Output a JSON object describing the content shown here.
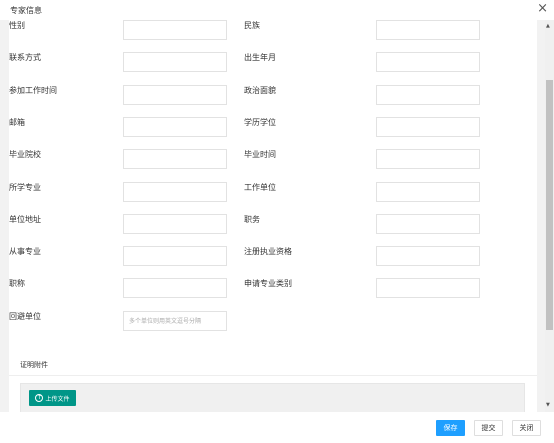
{
  "window": {
    "title": "专家信息",
    "close_glyph": "×"
  },
  "form": {
    "left": [
      {
        "label": "性别",
        "value": "",
        "placeholder": ""
      },
      {
        "label": "联系方式",
        "value": "",
        "placeholder": ""
      },
      {
        "label": "参加工作时间",
        "value": "",
        "placeholder": ""
      },
      {
        "label": "邮箱",
        "value": "",
        "placeholder": ""
      },
      {
        "label": "毕业院校",
        "value": "",
        "placeholder": ""
      },
      {
        "label": "所学专业",
        "value": "",
        "placeholder": ""
      },
      {
        "label": "单位地址",
        "value": "",
        "placeholder": ""
      },
      {
        "label": "从事专业",
        "value": "",
        "placeholder": ""
      },
      {
        "label": "职称",
        "value": "",
        "placeholder": ""
      },
      {
        "label": "回避单位",
        "value": "",
        "placeholder": "多个单位则用英文逗号分隔"
      }
    ],
    "right": [
      {
        "label": "民族",
        "value": "",
        "placeholder": ""
      },
      {
        "label": "出生年月",
        "value": "",
        "placeholder": ""
      },
      {
        "label": "政治面貌",
        "value": "",
        "placeholder": ""
      },
      {
        "label": "学历学位",
        "value": "",
        "placeholder": ""
      },
      {
        "label": "毕业时间",
        "value": "",
        "placeholder": ""
      },
      {
        "label": "工作单位",
        "value": "",
        "placeholder": ""
      },
      {
        "label": "职务",
        "value": "",
        "placeholder": ""
      },
      {
        "label": "注册执业资格",
        "value": "",
        "placeholder": ""
      },
      {
        "label": "申请专业类别",
        "value": "",
        "placeholder": ""
      }
    ]
  },
  "attachments": {
    "title": "证明附件",
    "upload_label": "上传文件",
    "upload_icon": "upload-arrow-icon"
  },
  "footer": {
    "save": "保存",
    "submit": "提交",
    "close": "关闭"
  },
  "colors": {
    "primary": "#1e9fff",
    "upload": "#009688",
    "panel_bg": "#f2f2f2"
  }
}
